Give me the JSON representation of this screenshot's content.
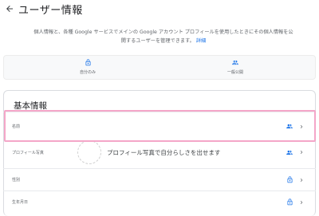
{
  "header": {
    "title": "ユーザー情報",
    "back_icon": "arrow-back-icon"
  },
  "intro": {
    "text": "個人情報と、各種 Google サービスでメインの Google アカウント プロフィールを使用したときにその個人情報を公開するユーザーを管理できます。",
    "link": "詳細"
  },
  "legend": {
    "private_label": "自分のみ",
    "private_icon": "lock-icon",
    "public_label": "一般公開",
    "public_icon": "people-icon"
  },
  "basic_info": {
    "title": "基本情報",
    "rows": [
      {
        "label": "名前",
        "value": "",
        "visibility": "people-icon"
      },
      {
        "label": "プロフィール写真",
        "value": "プロフィール写真で自分らしさを出せます",
        "visibility": "people-icon"
      },
      {
        "label": "性別",
        "value": "",
        "visibility": "lock-icon"
      },
      {
        "label": "生年月日",
        "value": "",
        "visibility": "lock-icon"
      }
    ]
  },
  "colors": {
    "accent": "#1a73e8",
    "highlight": "#f4a6c8",
    "legend_bg": "#f8f9fa"
  }
}
